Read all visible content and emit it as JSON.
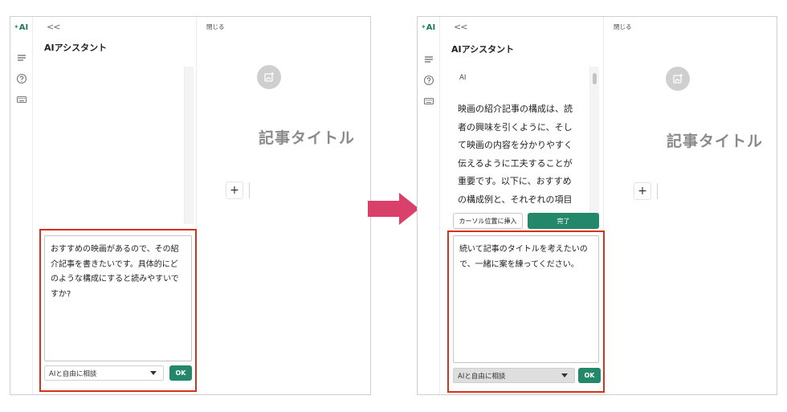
{
  "left_screen": {
    "rail": {
      "ai_badge": "AI",
      "icons": [
        "ai-spark-icon",
        "list-icon",
        "help-circle-icon",
        "keyboard-icon"
      ]
    },
    "assistant": {
      "collapse_label": "<<",
      "title": "AIアシスタント",
      "prompt_text": "おすすめの映画があるので、その紹介記事を書きたいです。具体的にどのような構成にすると読みやすいですか?",
      "mode_select": "AIと自由に相談",
      "ok_label": "OK"
    },
    "editor": {
      "close_label": "閉じる",
      "article_title": "記事タイトル",
      "add_block_label": "+"
    }
  },
  "right_screen": {
    "rail": {
      "ai_badge": "AI",
      "icons": [
        "ai-spark-icon",
        "list-icon",
        "help-circle-icon",
        "keyboard-icon"
      ]
    },
    "assistant": {
      "collapse_label": "<<",
      "title": "AIアシスタント",
      "response_label": "AI",
      "response_text": "映画の紹介記事の構成は、読者の興味を引くように、そして映画の内容を分かりやすく伝えるように工夫することが重要です。以下に、おすすめの構成例と、それぞれの項目",
      "insert_button": "カーソル位置に挿入",
      "done_button": "完了",
      "prompt_text": "続いて記事のタイトルを考えたいので、一緒に案を練ってください。",
      "mode_select": "AIと自由に相談",
      "ok_label": "OK"
    },
    "editor": {
      "close_label": "閉じる",
      "article_title": "記事タイトル",
      "add_block_label": "+"
    }
  },
  "colors": {
    "accent_green": "#23876a",
    "highlight_red": "#d6331f",
    "flow_arrow": "#d9416b",
    "title_gray": "#8a8a8a"
  }
}
